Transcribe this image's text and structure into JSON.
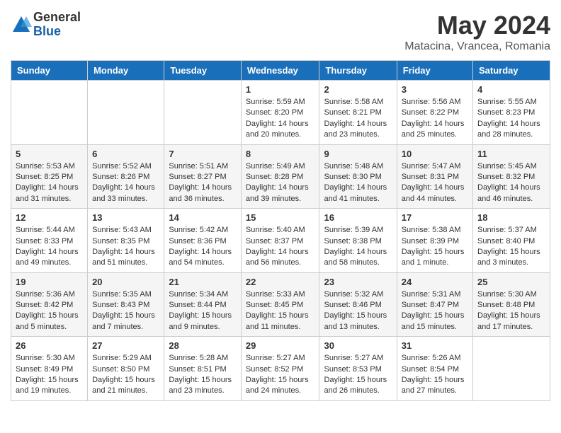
{
  "logo": {
    "general": "General",
    "blue": "Blue"
  },
  "title": "May 2024",
  "location": "Matacina, Vrancea, Romania",
  "weekdays": [
    "Sunday",
    "Monday",
    "Tuesday",
    "Wednesday",
    "Thursday",
    "Friday",
    "Saturday"
  ],
  "weeks": [
    [
      {
        "day": "",
        "info": ""
      },
      {
        "day": "",
        "info": ""
      },
      {
        "day": "",
        "info": ""
      },
      {
        "day": "1",
        "info": "Sunrise: 5:59 AM\nSunset: 8:20 PM\nDaylight: 14 hours\nand 20 minutes."
      },
      {
        "day": "2",
        "info": "Sunrise: 5:58 AM\nSunset: 8:21 PM\nDaylight: 14 hours\nand 23 minutes."
      },
      {
        "day": "3",
        "info": "Sunrise: 5:56 AM\nSunset: 8:22 PM\nDaylight: 14 hours\nand 25 minutes."
      },
      {
        "day": "4",
        "info": "Sunrise: 5:55 AM\nSunset: 8:23 PM\nDaylight: 14 hours\nand 28 minutes."
      }
    ],
    [
      {
        "day": "5",
        "info": "Sunrise: 5:53 AM\nSunset: 8:25 PM\nDaylight: 14 hours\nand 31 minutes."
      },
      {
        "day": "6",
        "info": "Sunrise: 5:52 AM\nSunset: 8:26 PM\nDaylight: 14 hours\nand 33 minutes."
      },
      {
        "day": "7",
        "info": "Sunrise: 5:51 AM\nSunset: 8:27 PM\nDaylight: 14 hours\nand 36 minutes."
      },
      {
        "day": "8",
        "info": "Sunrise: 5:49 AM\nSunset: 8:28 PM\nDaylight: 14 hours\nand 39 minutes."
      },
      {
        "day": "9",
        "info": "Sunrise: 5:48 AM\nSunset: 8:30 PM\nDaylight: 14 hours\nand 41 minutes."
      },
      {
        "day": "10",
        "info": "Sunrise: 5:47 AM\nSunset: 8:31 PM\nDaylight: 14 hours\nand 44 minutes."
      },
      {
        "day": "11",
        "info": "Sunrise: 5:45 AM\nSunset: 8:32 PM\nDaylight: 14 hours\nand 46 minutes."
      }
    ],
    [
      {
        "day": "12",
        "info": "Sunrise: 5:44 AM\nSunset: 8:33 PM\nDaylight: 14 hours\nand 49 minutes."
      },
      {
        "day": "13",
        "info": "Sunrise: 5:43 AM\nSunset: 8:35 PM\nDaylight: 14 hours\nand 51 minutes."
      },
      {
        "day": "14",
        "info": "Sunrise: 5:42 AM\nSunset: 8:36 PM\nDaylight: 14 hours\nand 54 minutes."
      },
      {
        "day": "15",
        "info": "Sunrise: 5:40 AM\nSunset: 8:37 PM\nDaylight: 14 hours\nand 56 minutes."
      },
      {
        "day": "16",
        "info": "Sunrise: 5:39 AM\nSunset: 8:38 PM\nDaylight: 14 hours\nand 58 minutes."
      },
      {
        "day": "17",
        "info": "Sunrise: 5:38 AM\nSunset: 8:39 PM\nDaylight: 15 hours\nand 1 minute."
      },
      {
        "day": "18",
        "info": "Sunrise: 5:37 AM\nSunset: 8:40 PM\nDaylight: 15 hours\nand 3 minutes."
      }
    ],
    [
      {
        "day": "19",
        "info": "Sunrise: 5:36 AM\nSunset: 8:42 PM\nDaylight: 15 hours\nand 5 minutes."
      },
      {
        "day": "20",
        "info": "Sunrise: 5:35 AM\nSunset: 8:43 PM\nDaylight: 15 hours\nand 7 minutes."
      },
      {
        "day": "21",
        "info": "Sunrise: 5:34 AM\nSunset: 8:44 PM\nDaylight: 15 hours\nand 9 minutes."
      },
      {
        "day": "22",
        "info": "Sunrise: 5:33 AM\nSunset: 8:45 PM\nDaylight: 15 hours\nand 11 minutes."
      },
      {
        "day": "23",
        "info": "Sunrise: 5:32 AM\nSunset: 8:46 PM\nDaylight: 15 hours\nand 13 minutes."
      },
      {
        "day": "24",
        "info": "Sunrise: 5:31 AM\nSunset: 8:47 PM\nDaylight: 15 hours\nand 15 minutes."
      },
      {
        "day": "25",
        "info": "Sunrise: 5:30 AM\nSunset: 8:48 PM\nDaylight: 15 hours\nand 17 minutes."
      }
    ],
    [
      {
        "day": "26",
        "info": "Sunrise: 5:30 AM\nSunset: 8:49 PM\nDaylight: 15 hours\nand 19 minutes."
      },
      {
        "day": "27",
        "info": "Sunrise: 5:29 AM\nSunset: 8:50 PM\nDaylight: 15 hours\nand 21 minutes."
      },
      {
        "day": "28",
        "info": "Sunrise: 5:28 AM\nSunset: 8:51 PM\nDaylight: 15 hours\nand 23 minutes."
      },
      {
        "day": "29",
        "info": "Sunrise: 5:27 AM\nSunset: 8:52 PM\nDaylight: 15 hours\nand 24 minutes."
      },
      {
        "day": "30",
        "info": "Sunrise: 5:27 AM\nSunset: 8:53 PM\nDaylight: 15 hours\nand 26 minutes."
      },
      {
        "day": "31",
        "info": "Sunrise: 5:26 AM\nSunset: 8:54 PM\nDaylight: 15 hours\nand 27 minutes."
      },
      {
        "day": "",
        "info": ""
      }
    ]
  ]
}
